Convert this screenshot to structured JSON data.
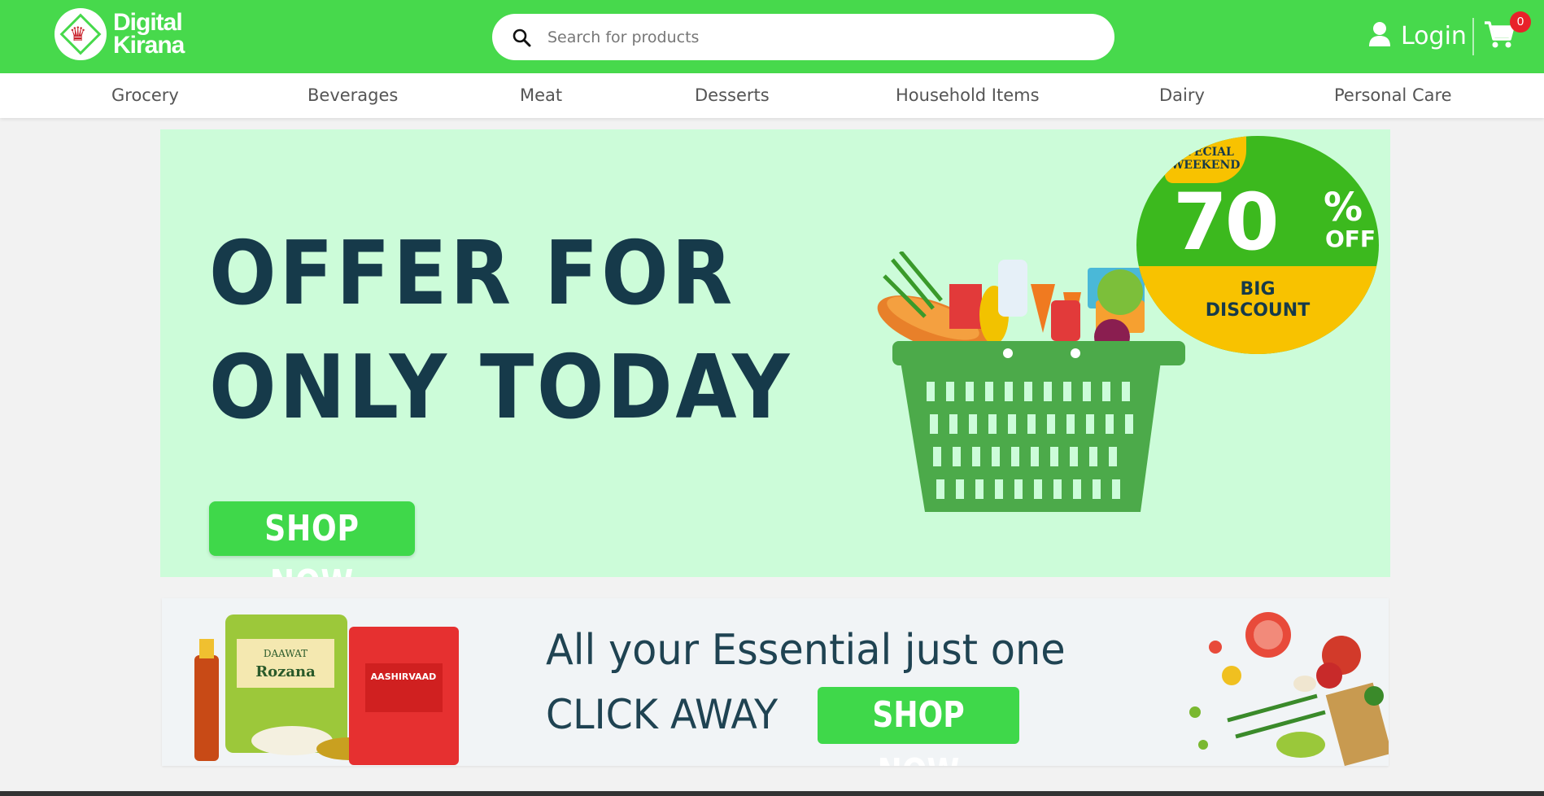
{
  "header": {
    "logo": {
      "line1": "Digital",
      "line2": "Kirana"
    },
    "search": {
      "placeholder": "Search for products"
    },
    "login_label": "Login",
    "cart_count": "0"
  },
  "nav": {
    "items": [
      "Grocery",
      "Beverages",
      "Meat",
      "Desserts",
      "Household Items",
      "Dairy",
      "Personal Care"
    ]
  },
  "hero": {
    "title_line1": "OFFER FOR",
    "title_line2": "ONLY TODAY",
    "button_label": "SHOP NOW",
    "badge": {
      "special_line1": "SPECIAL",
      "special_line2": "WEEKEND",
      "percent": "70",
      "percent_sign": "%",
      "off": "OFF",
      "big_line1": "BIG",
      "big_line2": "DISCOUNT"
    }
  },
  "banner2": {
    "line1": "All your Essential just one",
    "line2": "CLICK AWAY",
    "button_label": "SHOP NOW",
    "products": {
      "brand1_line1": "DAAWAT",
      "brand1_line2": "Rozana",
      "brand2": "AASHIRVAAD"
    }
  },
  "colors": {
    "header_green": "#47d94c",
    "button_green": "#3fd84a",
    "hero_bg": "#ccfcd9",
    "title_navy": "#163a4a",
    "badge_red": "#e8222a",
    "badge_yellow": "#f8c200"
  },
  "icons": [
    "search-icon",
    "user-icon",
    "cart-icon",
    "logo-crown-icon"
  ]
}
